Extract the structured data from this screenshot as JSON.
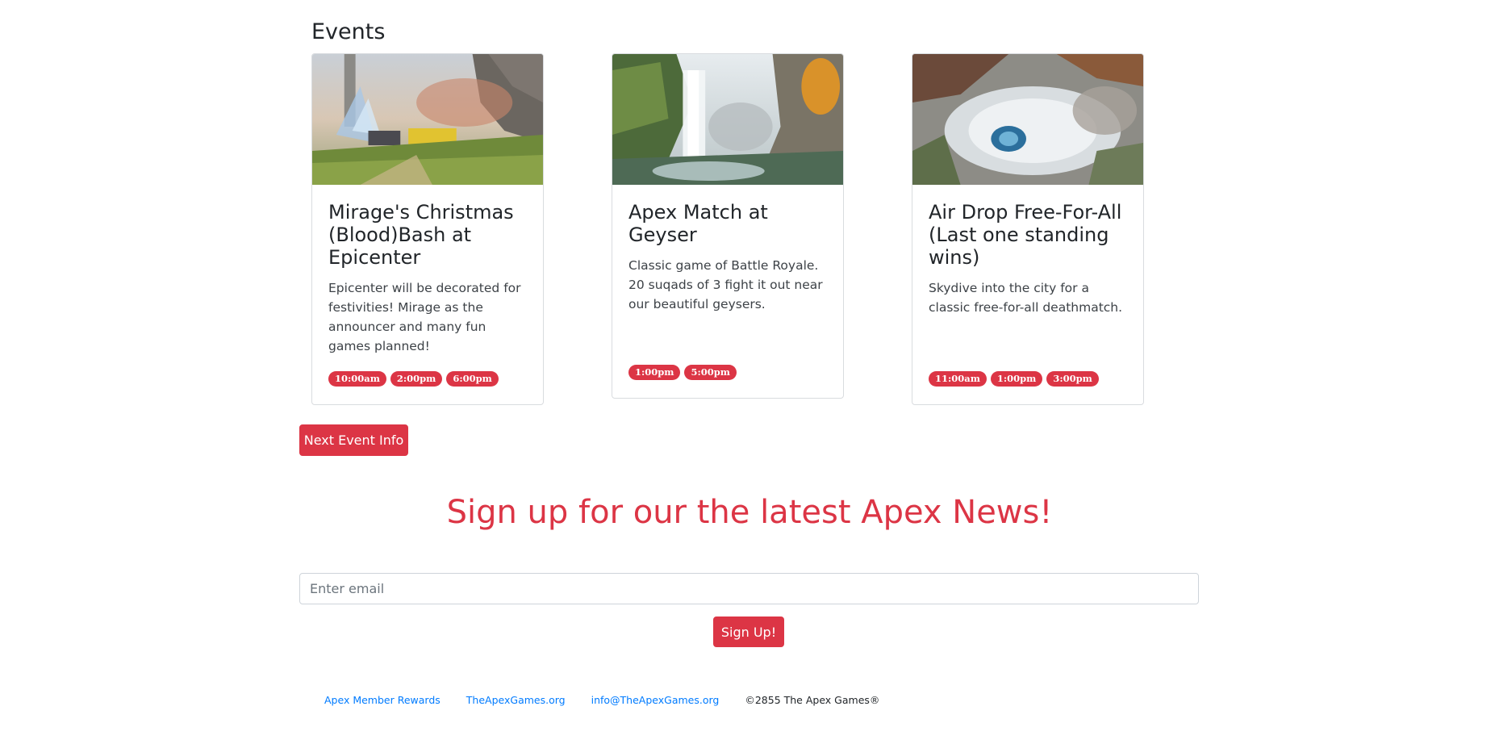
{
  "section": {
    "title": "Events"
  },
  "events": [
    {
      "title": "Mirage's Christmas (Blood)Bash at Epicenter",
      "description": "Epicenter will be decorated for festivities! Mirage as the announcer and many fun games planned!",
      "times": [
        "10:00am",
        "2:00pm",
        "6:00pm"
      ]
    },
    {
      "title": "Apex Match at Geyser",
      "description": "Classic game of Battle Royale. 20 suqads of 3 fight it out near our beautiful geysers.",
      "times": [
        "1:00pm",
        "5:00pm"
      ]
    },
    {
      "title": "Air Drop Free-For-All (Last one standing wins)",
      "description": "Skydive into the city for a classic free-for-all deathmatch.",
      "times": [
        "11:00am",
        "1:00pm",
        "3:00pm"
      ]
    }
  ],
  "next_event_button": "Next Event Info",
  "signup": {
    "heading": "Sign up for our the latest Apex News!",
    "email_placeholder": "Enter email",
    "button": "Sign Up!"
  },
  "footer": {
    "links": [
      "Apex Member Rewards",
      "TheApexGames.org",
      "info@TheApexGames.org"
    ],
    "copyright": "©2855 The Apex Games®"
  },
  "colors": {
    "accent": "#dc3545",
    "link": "#007bff"
  }
}
